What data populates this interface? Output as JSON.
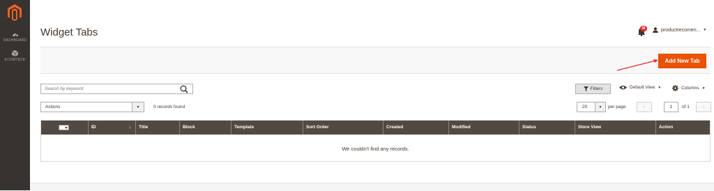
{
  "sidebar": {
    "logo": "magento-logo",
    "items": [
      {
        "label": "DASHBOARD",
        "icon": "dashboard-icon"
      },
      {
        "label": "ECOMTECK",
        "icon": "cube-icon"
      }
    ]
  },
  "header": {
    "title": "Widget Tabs",
    "notification_count": "38",
    "username": "productrecomen..."
  },
  "actionbar": {
    "add_label": "Add New Tab"
  },
  "toolbar": {
    "search_placeholder": "Search by keyword",
    "filters_label": "Filters",
    "view_label": "Default View",
    "columns_label": "Columns",
    "actions_label": "Actions",
    "records_found": "0 records found",
    "per_page_value": "20",
    "per_page_label": "per page",
    "page_value": "1",
    "page_of": "of 1"
  },
  "grid": {
    "columns": [
      "ID",
      "Title",
      "Block",
      "Template",
      "Sort Order",
      "Created",
      "Modified",
      "Status",
      "Store View",
      "Action"
    ],
    "empty_message": "We couldn't find any records."
  },
  "colors": {
    "sidebar_bg": "#373330",
    "accent": "#eb5202",
    "grid_header": "#514943",
    "annotation_arrow": "#e22626"
  }
}
